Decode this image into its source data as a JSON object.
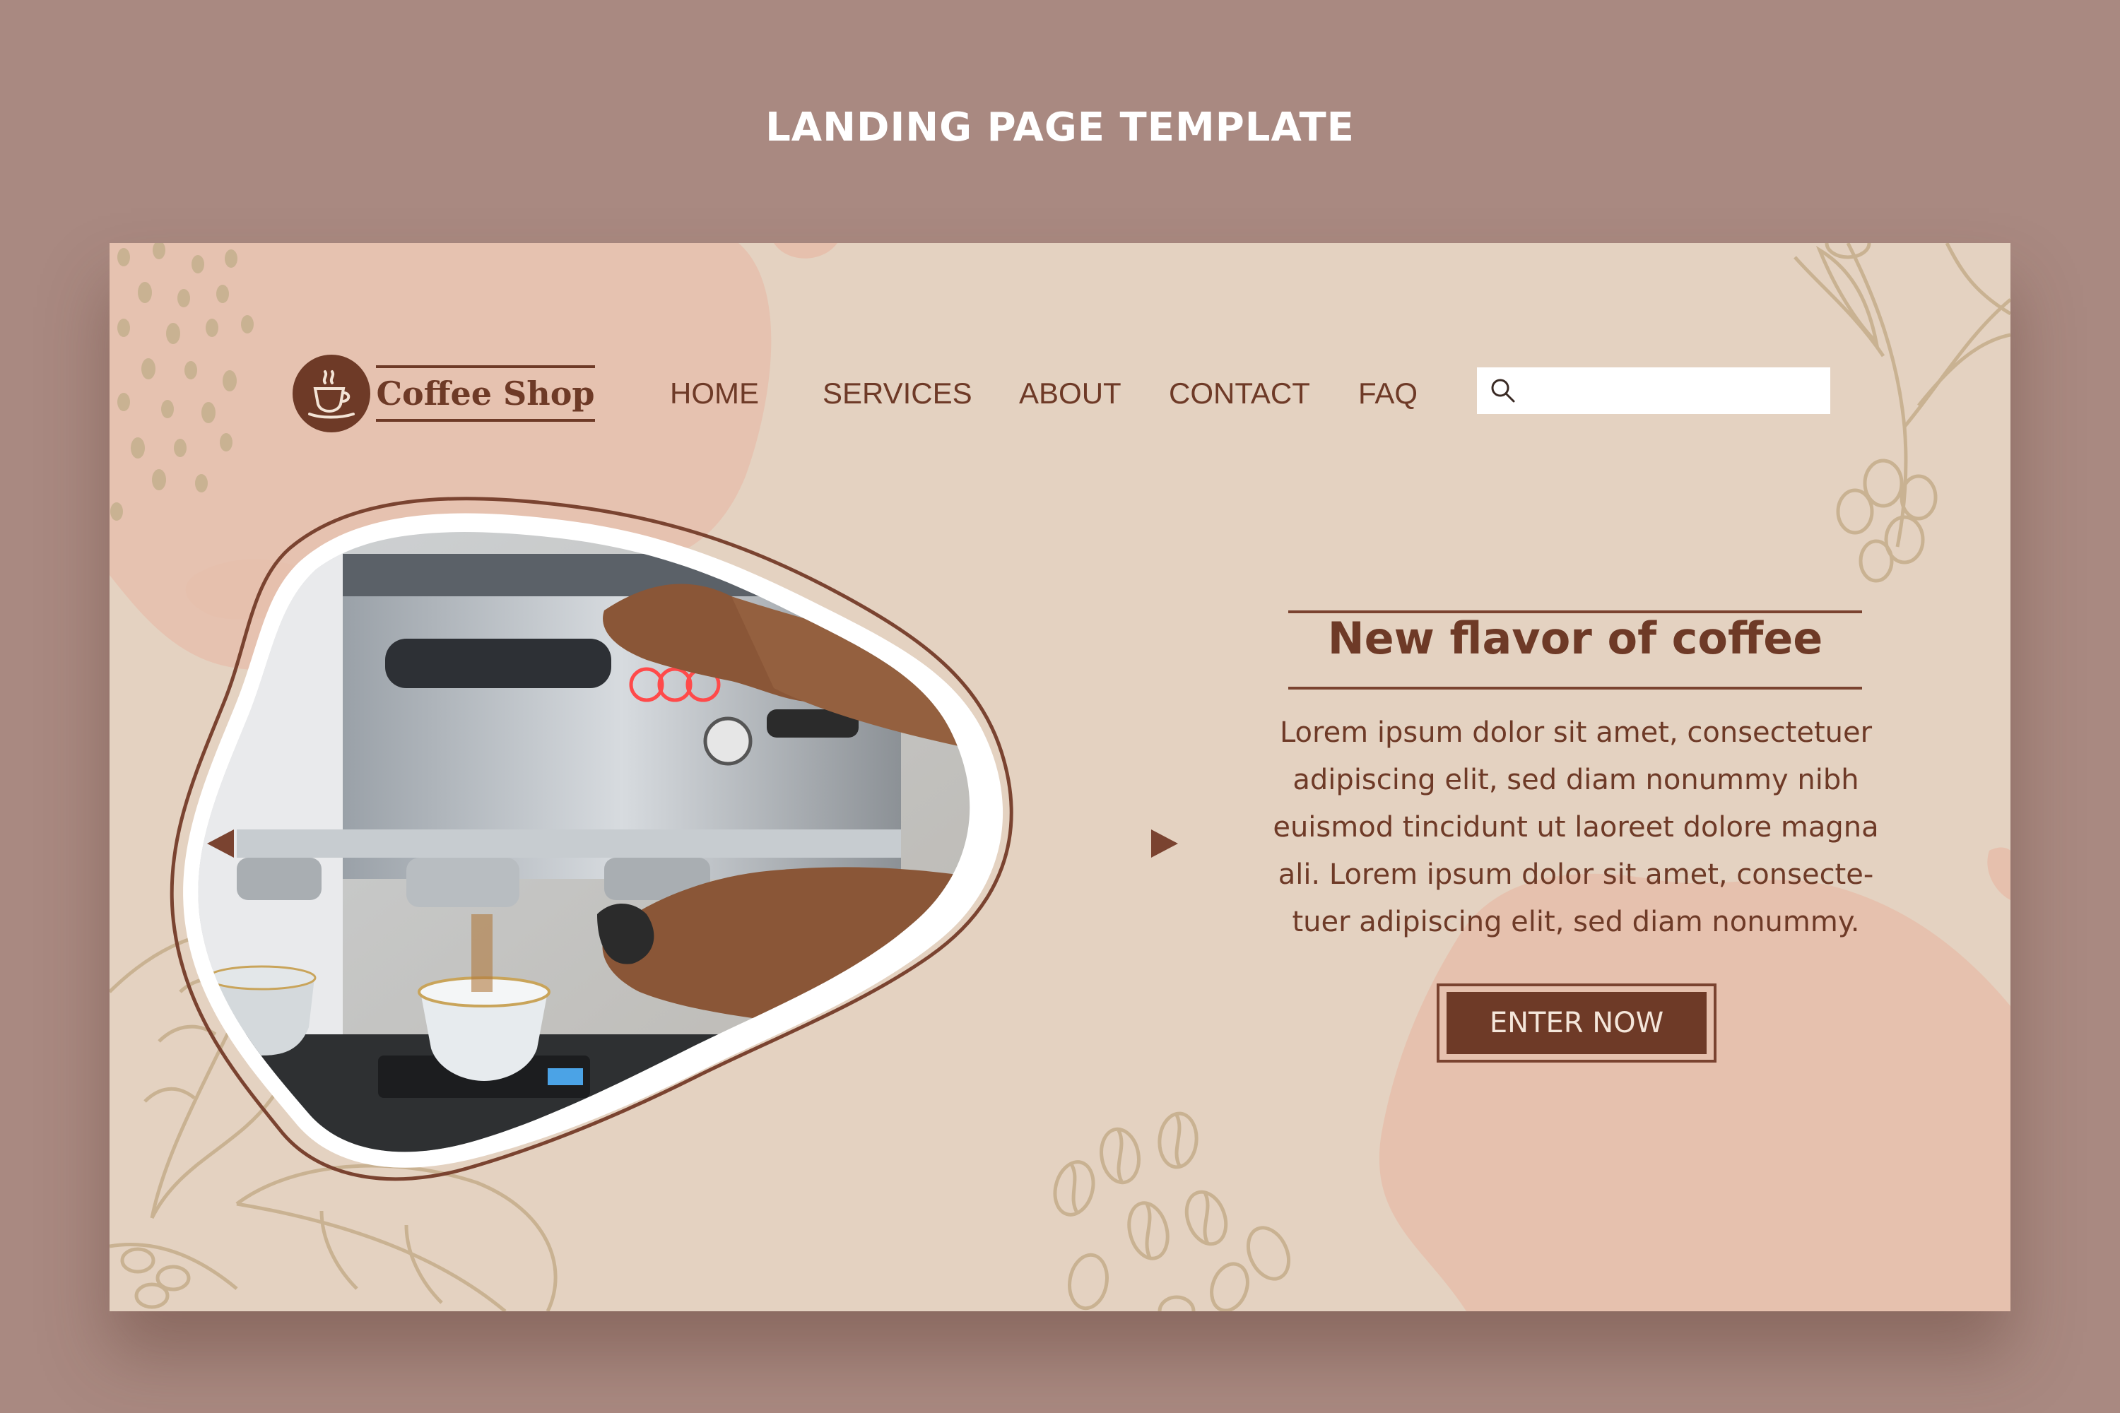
{
  "page": {
    "template_title": "LANDING PAGE TEMPLATE"
  },
  "header": {
    "brand_name": "Coffee Shop",
    "logo_icon": "coffee-cup-icon",
    "nav": [
      {
        "label": "HOME"
      },
      {
        "label": "SERVICES"
      },
      {
        "label": "ABOUT"
      },
      {
        "label": "CONTACT"
      },
      {
        "label": "FAQ"
      }
    ],
    "search": {
      "value": "",
      "placeholder": "",
      "icon": "search-icon"
    }
  },
  "hero": {
    "image": "barista-espresso-machine-photo",
    "prev_icon": "triangle-left-icon",
    "next_icon": "triangle-right-icon",
    "headline": "New flavor of coffee",
    "body_lines": [
      "Lorem ipsum dolor sit amet, consectetuer",
      "adipiscing elit, sed diam nonummy nibh",
      "euismod tincidunt ut laoreet dolore magna",
      "ali. Lorem ipsum dolor sit amet, consecte-",
      "tuer adipiscing elit, sed diam nonummy."
    ],
    "cta_label": "ENTER NOW"
  },
  "colors": {
    "outer_background": "#a98981",
    "card_background": "#e4d2c1",
    "brand_brown": "#6e3a27",
    "blob_pink": "#e6c0ad",
    "line_art": "#c9b292",
    "white": "#ffffff"
  }
}
